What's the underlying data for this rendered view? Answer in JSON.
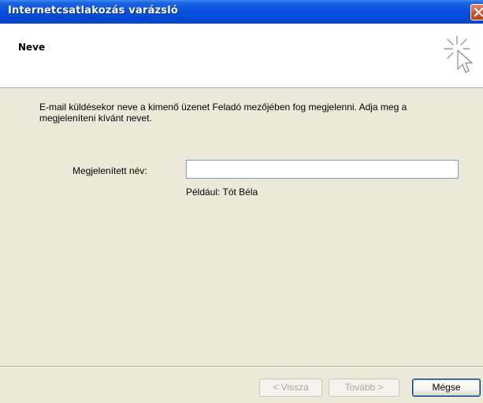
{
  "window": {
    "title": "Internetcsatlakozás varázsló",
    "close_icon": "close-icon"
  },
  "header": {
    "title": "Neve",
    "icon": "wizard-sparkle-cursor-icon"
  },
  "main": {
    "description": "E-mail küldésekor neve a kimenő üzenet Feladó mezőjében fog megjelenni. Adja meg a megjeleníteni kívánt nevet.",
    "display_name_label": "Megjelenített név:",
    "display_name_value": "",
    "example_text": "Például: Tót Béla"
  },
  "footer": {
    "back_label": "< Vissza",
    "next_label": "Tovább >",
    "cancel_label": "Mégse"
  },
  "colors": {
    "titlebar": "#0A54E3",
    "dialog_bg": "#ECE9D8",
    "header_bg": "#FFFFFF",
    "close_button": "#D8532B"
  }
}
